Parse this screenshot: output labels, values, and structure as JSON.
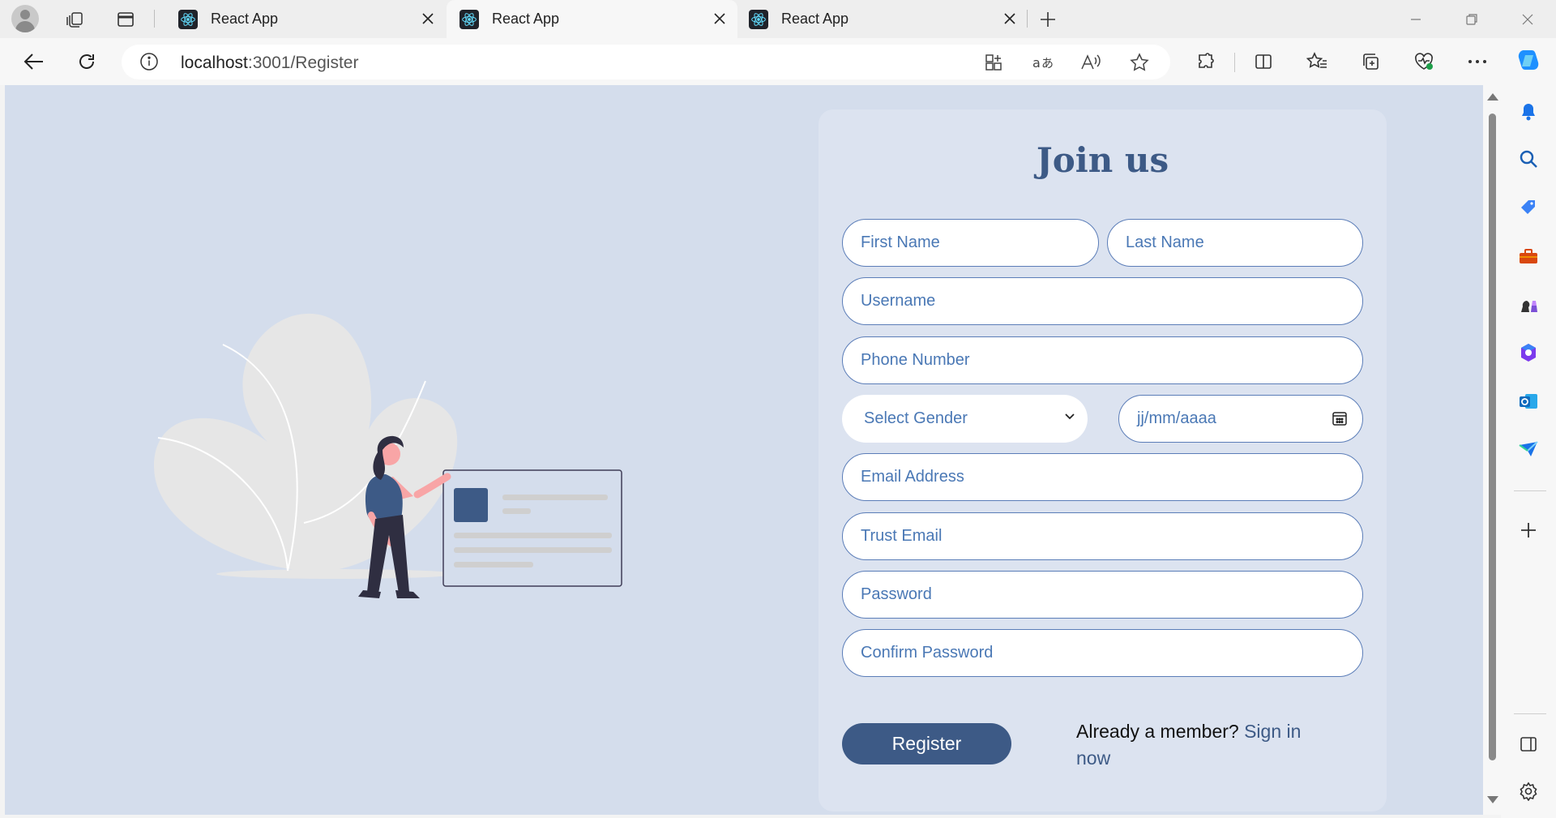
{
  "browser": {
    "tabs": [
      {
        "title": "React App",
        "active": false
      },
      {
        "title": "React App",
        "active": true
      },
      {
        "title": "React App",
        "active": false
      }
    ],
    "address": {
      "host": "localhost",
      "path": ":3001/Register"
    }
  },
  "form": {
    "title": "Join us",
    "first_name_placeholder": "First Name",
    "last_name_placeholder": "Last Name",
    "username_placeholder": "Username",
    "phone_placeholder": "Phone Number",
    "gender_selected": "Select Gender",
    "date_placeholder": "jj/mm/aaaa",
    "email_placeholder": "Email Address",
    "trust_email_placeholder": "Trust Email",
    "password_placeholder": "Password",
    "confirm_password_placeholder": "Confirm Password",
    "register_label": "Register",
    "member_text": "Already a member?",
    "sign_in_link": "Sign in now"
  },
  "colors": {
    "page_background": "#d4ddec",
    "card_background": "#dce3f0",
    "accent": "#3d5a86",
    "placeholder_text": "#4a78b5",
    "illustration_leaf": "#e6e6e6",
    "illustration_shirt": "#3d5a86",
    "illustration_skin": "#f8a5a6"
  },
  "sidebar": {
    "icons": [
      "copilot-icon",
      "bell-icon",
      "search-icon",
      "tag-icon",
      "toolbox-icon",
      "chess-icon",
      "office-icon",
      "outlook-icon",
      "send-icon",
      "add-icon",
      "panel-icon",
      "settings-icon"
    ]
  }
}
